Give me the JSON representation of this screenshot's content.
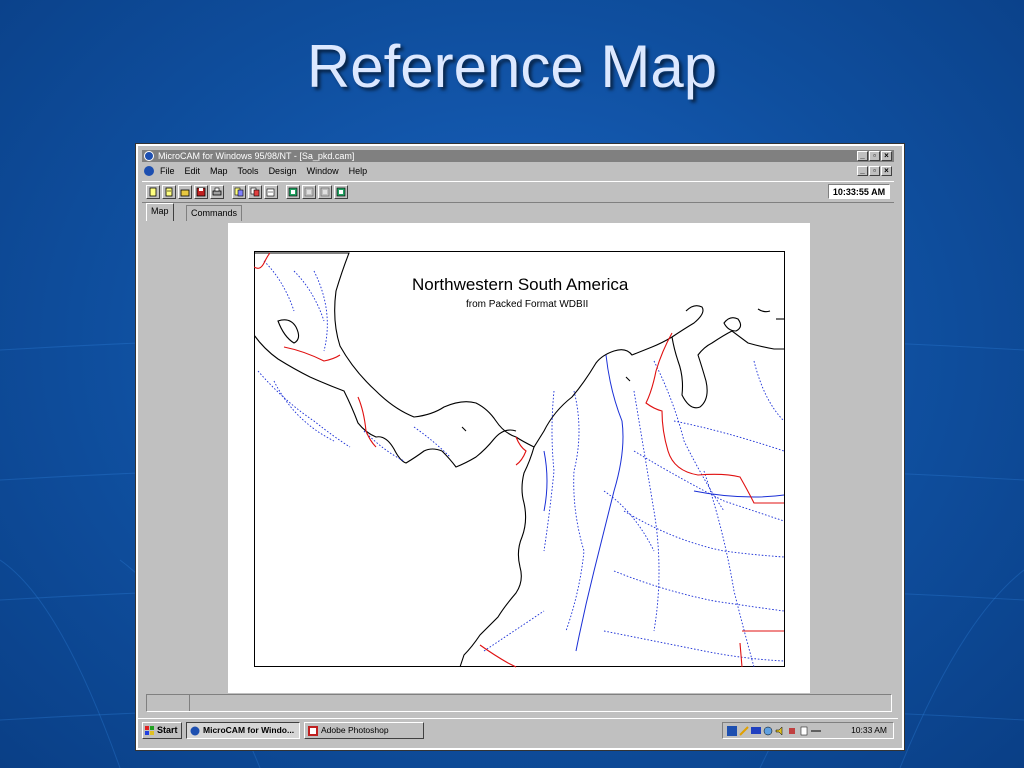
{
  "slide": {
    "title": "Reference Map"
  },
  "window": {
    "title": "MicroCAM for Windows 95/98/NT - [Sa_pkd.cam]",
    "controls": {
      "minimize": "_",
      "restore": "▫",
      "close": "×"
    }
  },
  "menubar": {
    "items": [
      "File",
      "Edit",
      "Map",
      "Tools",
      "Design",
      "Window",
      "Help"
    ]
  },
  "toolbar": {
    "clock": "10:33:55 AM"
  },
  "tabs": [
    {
      "label": "Map",
      "active": true
    },
    {
      "label": "Commands",
      "active": false
    }
  ],
  "map": {
    "title": "Northwestern South America",
    "subtitle": "from Packed Format WDBII",
    "colors": {
      "coast": "#000000",
      "rivers": "#1a2fd6",
      "borders": "#e01010"
    }
  },
  "taskbar": {
    "start_label": "Start",
    "tasks": [
      {
        "label": "MicroCAM for Windo...",
        "pressed": true
      },
      {
        "label": "Adobe Photoshop",
        "pressed": false
      }
    ],
    "clock": "10:33 AM"
  }
}
